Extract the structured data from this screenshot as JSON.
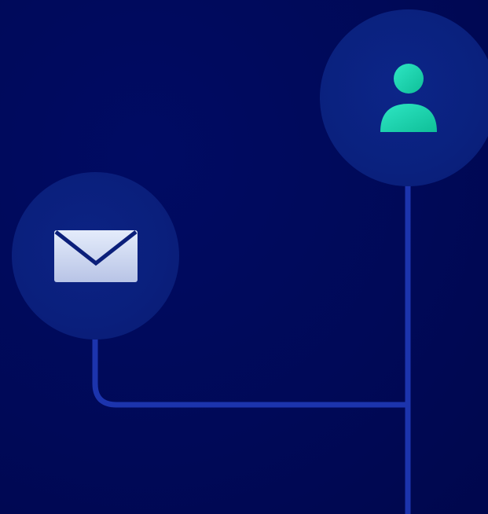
{
  "colors": {
    "background": "#000957",
    "connector": "#1c34ad",
    "node_fill": "#0a1f7c",
    "envelope_light": "#e4ecfb",
    "envelope_dark": "#b8c4e6",
    "envelope_stroke": "#0b1f7a",
    "person_top": "#2ee6c4",
    "person_bottom": "#0fbf98"
  },
  "nodes": [
    {
      "id": "mail",
      "icon": "envelope-icon"
    },
    {
      "id": "user",
      "icon": "person-icon"
    }
  ]
}
